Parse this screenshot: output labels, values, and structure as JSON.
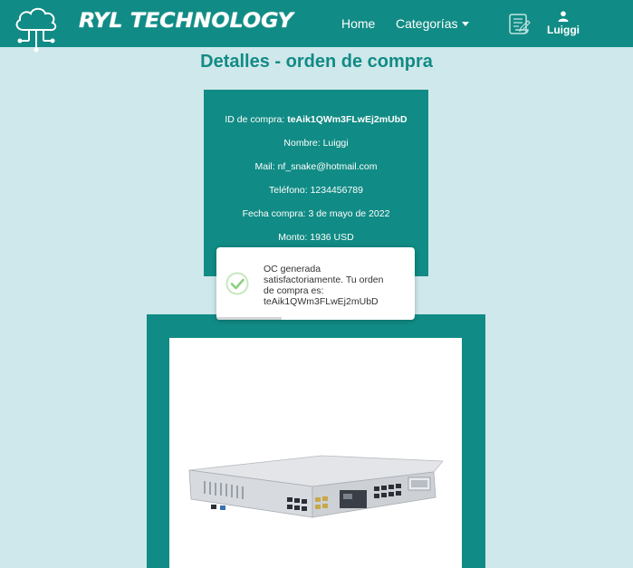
{
  "navbar": {
    "brand": "RYL TECHNOLOGY",
    "home_label": "Home",
    "categories_label": "Categorías",
    "user_label": "Luiggi",
    "icons": [
      "cloud-network-logo-icon",
      "orders-scroll-icon",
      "user-icon",
      "chevron-down-icon"
    ]
  },
  "page": {
    "title": "Detalles - orden de compra"
  },
  "details": {
    "id_label": "ID de compra:",
    "id_value": "teAik1QWm3FLwEj2mUbD",
    "name_label": "Nombre:",
    "name_value": "Luiggi",
    "mail_label": "Mail:",
    "mail_value": "nf_snake@hotmail.com",
    "phone_label": "Teléfono:",
    "phone_value": "1234456789",
    "date_label": "Fecha compra:",
    "date_value": "3 de mayo de 2022",
    "amount_label": "Monto:",
    "amount_value": "1936 USD"
  },
  "toast": {
    "line1": "OC generada",
    "line2": "satisfactoriamente. Tu orden",
    "line3": "de compra es:",
    "line4": "teAik1QWm3FLwEj2mUbD",
    "icon": "success-check-icon"
  },
  "colors": {
    "primary": "#118b85",
    "background": "#cfe8eb",
    "success": "#8bd17c"
  }
}
